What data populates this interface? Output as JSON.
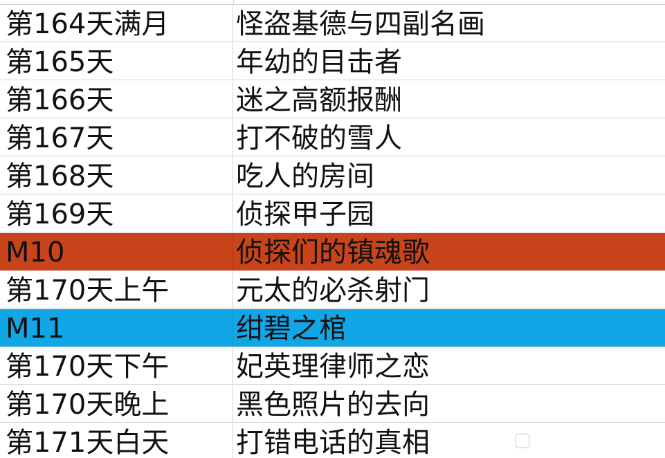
{
  "rows": [
    {
      "day": "第164天满月",
      "title": "怪盗基德与四副名画",
      "highlight": ""
    },
    {
      "day": "第165天",
      "title": "年幼的目击者",
      "highlight": ""
    },
    {
      "day": "第166天",
      "title": "迷之高额报酬",
      "highlight": ""
    },
    {
      "day": "第167天",
      "title": "打不破的雪人",
      "highlight": ""
    },
    {
      "day": "第168天",
      "title": "吃人的房间",
      "highlight": ""
    },
    {
      "day": "第169天",
      "title": "侦探甲子园",
      "highlight": ""
    },
    {
      "day": "M10",
      "title": "侦探们的镇魂歌",
      "highlight": "#c9441a"
    },
    {
      "day": "第170天上午",
      "title": "元太的必杀射门",
      "highlight": ""
    },
    {
      "day": "M11",
      "title": "绀碧之棺",
      "highlight": "#11a6e6"
    },
    {
      "day": "第170天下午",
      "title": "妃英理律师之恋",
      "highlight": ""
    },
    {
      "day": "第170天晚上",
      "title": "黑色照片的去向",
      "highlight": ""
    },
    {
      "day": "第171天白天",
      "title": "打错电话的真相",
      "highlight": ""
    }
  ]
}
